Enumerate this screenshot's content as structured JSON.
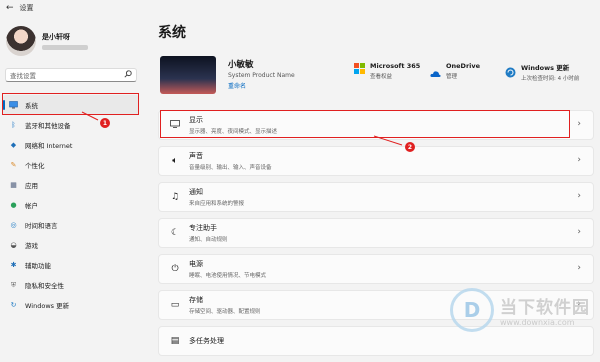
{
  "window": {
    "title": "设置",
    "back_icon": "back-arrow-icon"
  },
  "sidebar": {
    "profile": {
      "name": "是小轩呀"
    },
    "search": {
      "placeholder": "查找设置"
    },
    "items": [
      {
        "label": "系统",
        "icon": "monitor-icon",
        "active": true
      },
      {
        "label": "蓝牙和其他设备",
        "icon": "bluetooth-icon"
      },
      {
        "label": "网络和 Internet",
        "icon": "wifi-icon"
      },
      {
        "label": "个性化",
        "icon": "brush-icon"
      },
      {
        "label": "应用",
        "icon": "apps-icon"
      },
      {
        "label": "帐户",
        "icon": "account-icon"
      },
      {
        "label": "时间和语言",
        "icon": "globe-icon"
      },
      {
        "label": "游戏",
        "icon": "gamepad-icon"
      },
      {
        "label": "辅助功能",
        "icon": "accessibility-icon"
      },
      {
        "label": "隐私和安全性",
        "icon": "shield-icon"
      },
      {
        "label": "Windows 更新",
        "icon": "update-icon"
      }
    ],
    "annotation_number": "1"
  },
  "main": {
    "title": "系统",
    "device": {
      "name": "小敏敏",
      "model": "System Product Name",
      "rename": "重命名"
    },
    "quick": [
      {
        "title": "Microsoft 365",
        "sub": "查看权益"
      },
      {
        "title": "OneDrive",
        "sub": "管理"
      },
      {
        "title": "Windows 更新",
        "sub": "上次检查时间: 4 小时前"
      }
    ],
    "cards": [
      {
        "title": "显示",
        "sub": "显示器、亮度、夜间模式、显示描述"
      },
      {
        "title": "声音",
        "sub": "音量级别、输出、输入、声音设备"
      },
      {
        "title": "通知",
        "sub": "来自应用和系统的警报"
      },
      {
        "title": "专注助手",
        "sub": "通知、自动规则"
      },
      {
        "title": "电源",
        "sub": "睡眠、电池使用情况、节电模式"
      },
      {
        "title": "存储",
        "sub": "存储空间、驱动器、配置规则"
      },
      {
        "title": "多任务处理",
        "sub": ""
      }
    ],
    "annotation_number": "2"
  },
  "watermark": {
    "cn": "当下软件园",
    "url": "www.downxia.com"
  },
  "colors": {
    "accent": "#0067c0",
    "annotation_red": "#e02020",
    "background": "#f3f3f3"
  }
}
